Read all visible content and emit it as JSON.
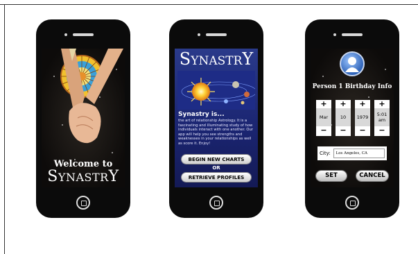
{
  "screen1": {
    "welcome": "Welcome to",
    "brand_first": "S",
    "brand_mid": "YNASTR",
    "brand_last": "Y"
  },
  "screen2": {
    "brand_first": "S",
    "brand_mid": "YNASTR",
    "brand_last": "Y",
    "about_title": "Synastry is...",
    "about_body": "the art of relationship Astrology. It is a fascinating and illuminating study of how individuals interact with one another. Our app will help you see strengths and weaknesses in your relationships as well as score it. Enjoy!",
    "begin_label": "BEGIN NEW CHARTS",
    "or_label": "OR",
    "retrieve_label": "RETRIEVE PROFILES"
  },
  "screen3": {
    "title": "Person 1 Birthday Info",
    "pickers": [
      {
        "plus": "+",
        "value": "Mar",
        "minus": "−"
      },
      {
        "plus": "+",
        "value": "10",
        "minus": "−"
      },
      {
        "plus": "+",
        "value": "1979",
        "minus": "−"
      },
      {
        "plus": "+",
        "value": "5:01 am",
        "minus": "−"
      }
    ],
    "city_label": "City:",
    "city_value": "Los Angeles, CA",
    "set_label": "SET",
    "cancel_label": "CANCEL"
  }
}
